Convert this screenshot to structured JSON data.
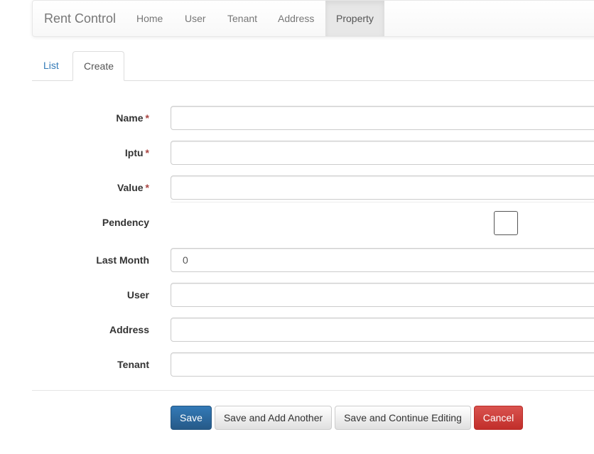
{
  "navbar": {
    "brand": "Rent Control",
    "items": [
      {
        "label": "Home"
      },
      {
        "label": "User"
      },
      {
        "label": "Tenant"
      },
      {
        "label": "Address"
      },
      {
        "label": "Property",
        "active": true
      }
    ]
  },
  "tabs": {
    "list": "List",
    "create": "Create",
    "active": "Create"
  },
  "form": {
    "required_marker": "*",
    "fields": {
      "name": {
        "label": "Name",
        "required": true,
        "value": ""
      },
      "iptu": {
        "label": "Iptu",
        "required": true,
        "value": ""
      },
      "value": {
        "label": "Value",
        "required": true,
        "value": ""
      },
      "pendency": {
        "label": "Pendency",
        "checked": false
      },
      "last_month": {
        "label": "Last Month",
        "value": "0"
      },
      "user": {
        "label": "User",
        "value": ""
      },
      "address": {
        "label": "Address",
        "value": ""
      },
      "tenant": {
        "label": "Tenant",
        "value": ""
      }
    }
  },
  "actions": {
    "save": "Save",
    "save_add_another": "Save and Add Another",
    "save_continue": "Save and Continue Editing",
    "cancel": "Cancel"
  },
  "colors": {
    "primary": "#337ab7",
    "danger": "#d9534f",
    "required": "#a94442"
  }
}
